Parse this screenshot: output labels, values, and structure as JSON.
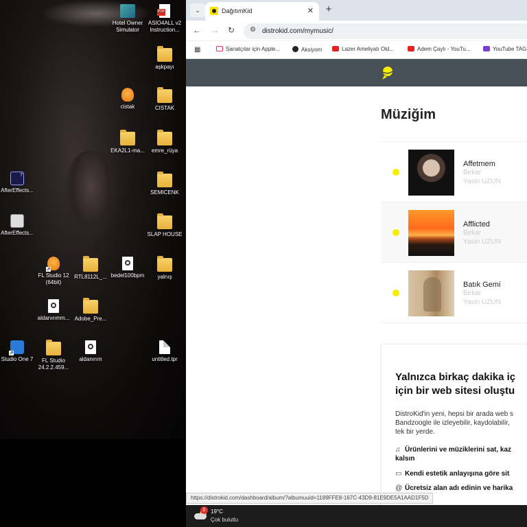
{
  "desktop": {
    "icons": [
      {
        "label": "Hotel Owner\nSimulator",
        "icon": "game-icon",
        "kind": "game"
      },
      {
        "label": "ASIO4ALL v2\nInstruction...",
        "icon": "pdf-icon",
        "kind": "pdf"
      },
      {
        "label": "aşkpayı",
        "icon": "folder-icon",
        "kind": "folder"
      },
      {
        "label": "cistak",
        "icon": "fl-studio-icon",
        "kind": "fl"
      },
      {
        "label": "CISTAK",
        "icon": "folder-icon",
        "kind": "folder"
      },
      {
        "label": "EKA2L1-ma...",
        "icon": "folder-icon",
        "kind": "folder"
      },
      {
        "label": "emre_rüya",
        "icon": "folder-icon",
        "kind": "folder"
      },
      {
        "label": "AfterEffects...",
        "icon": "after-effects-icon",
        "kind": "ae"
      },
      {
        "label": "SEMICENK",
        "icon": "folder-icon",
        "kind": "folder"
      },
      {
        "label": "AfterEffects...",
        "icon": "after-effects-icon",
        "kind": "aeg"
      },
      {
        "label": "SLAP HOUSE",
        "icon": "folder-icon",
        "kind": "folder"
      },
      {
        "label": "FL Studio 12\n(64bit)",
        "icon": "fl-studio-icon",
        "kind": "fl"
      },
      {
        "label": "RTL8112L_...",
        "icon": "folder-icon",
        "kind": "folder"
      },
      {
        "label": "bedel100bpm",
        "icon": "audio-file-icon",
        "kind": "media"
      },
      {
        "label": "yalnış",
        "icon": "folder-icon",
        "kind": "folder"
      },
      {
        "label": "aldanırımm...",
        "icon": "audio-file-icon",
        "kind": "media"
      },
      {
        "label": "Adobe_Pre...",
        "icon": "folder-icon",
        "kind": "folder"
      },
      {
        "label": "Studio One 7",
        "icon": "studio-one-icon",
        "kind": "so"
      },
      {
        "label": "FL Studio\n24.2.2.459...",
        "icon": "folder-icon",
        "kind": "folder"
      },
      {
        "label": "aldanırım",
        "icon": "audio-file-icon",
        "kind": "media"
      },
      {
        "label": "untitled.tpr",
        "icon": "file-icon",
        "kind": "doc"
      }
    ]
  },
  "browser": {
    "tab_title": "DağıtımKid",
    "tab_close": "✕",
    "new_tab": "+",
    "url": "distrokid.com/mymusic/",
    "bookmarks": [
      {
        "label": "",
        "type": "apps"
      },
      {
        "label": "Sanatçılar için Apple...",
        "type": "ap"
      },
      {
        "label": "Aksiyom",
        "type": "ak"
      },
      {
        "label": "Lazer Ameliyatı Old...",
        "type": "yt"
      },
      {
        "label": "Adem Çaylı - YouTu...",
        "type": "yt"
      },
      {
        "label": "YouTube TAG",
        "type": "tag"
      }
    ],
    "status_url": "https://distrokid.com/dashboard/album/?albumuuid=1189FFE8-167C-43D9-81E9DE5A1AAD1F5D"
  },
  "page": {
    "title": "Müziğim",
    "tracks": [
      {
        "title": "Affetmem",
        "type": "Bekar",
        "artist": "Yasin UZUN"
      },
      {
        "title": "Afflicted",
        "type": "Bekar",
        "artist": "Yasin UZUN"
      },
      {
        "title": "Batık Gemi",
        "type": "Bekar",
        "artist": "Yasin UZUN"
      }
    ],
    "promo": {
      "title": "Yalnızca birkaç dakika iç\niçin bir web sitesi oluştu",
      "body": "DistroKid'in yeni, hepsi bir arada web s\nBandzoogle ile izleyebilir, kaydolabilir,\ntek bir yerde.",
      "features": [
        {
          "icon": "♫",
          "text": "Ürünlerini ve müziklerini sat, kaz\nkalsın"
        },
        {
          "icon": "▭",
          "text": "Kendi estetik anlayışına göre sit"
        },
        {
          "icon": "@",
          "text": "Ücretsiz alan adı edinin ve harika"
        }
      ]
    }
  },
  "taskbar": {
    "weather_badge": "2",
    "temperature": "19°C",
    "condition": "Çok bulutlu"
  },
  "colors": {
    "site_header": "#475057",
    "status_dot": "#f5ee00"
  }
}
